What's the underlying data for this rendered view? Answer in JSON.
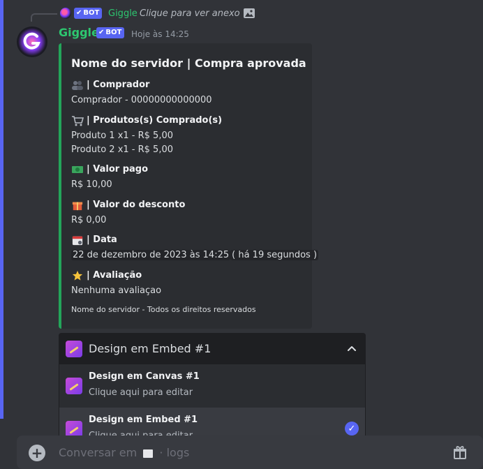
{
  "colors": {
    "accent": "#5865f2",
    "bot_name": "#2dc770",
    "embed_border": "#23a55a",
    "background": "#313338"
  },
  "reply": {
    "name": "Giggle",
    "badge": "BOT",
    "text": "Clique para ver anexo",
    "icon": "image-icon"
  },
  "message": {
    "author": "Giggle",
    "badge": "BOT",
    "timestamp": "Hoje às 14:25"
  },
  "embed": {
    "title": "Nome do servidor | Compra aprovada",
    "fields": [
      {
        "icon": "people-icon",
        "name": "| Comprador",
        "values": [
          "Comprador - 00000000000000"
        ]
      },
      {
        "icon": "cart-icon",
        "name": "| Produtos(s) Comprado(s)",
        "values": [
          "Produto 1 x1 - R$ 5,00",
          "Produto 2 x1 - R$ 5,00"
        ]
      },
      {
        "icon": "money-icon",
        "name": "| Valor pago",
        "values": [
          "R$ 10,00"
        ]
      },
      {
        "icon": "gift-icon",
        "name": "| Valor do desconto",
        "values": [
          "R$ 0,00"
        ]
      },
      {
        "icon": "calendar-icon",
        "name": "| Data",
        "values": [
          "22 de dezembro de 2023 às 14:25",
          "( há 19 segundos )"
        ]
      },
      {
        "icon": "star-icon",
        "name": "| Avaliação",
        "values": [
          "Nenhuma avaliaçao"
        ]
      }
    ],
    "footer": "Nome do servidor - Todos os direitos reservados"
  },
  "dropdown": {
    "selected": "Design em Embed #1",
    "options": [
      {
        "label": "Design em Canvas #1",
        "description": "Clique aqui para editar",
        "selected": false
      },
      {
        "label": "Design em Embed #1",
        "description": "Clique aqui para editar",
        "selected": true
      }
    ]
  },
  "composer": {
    "placeholder": "Conversar em",
    "channel_suffix": "· logs"
  }
}
